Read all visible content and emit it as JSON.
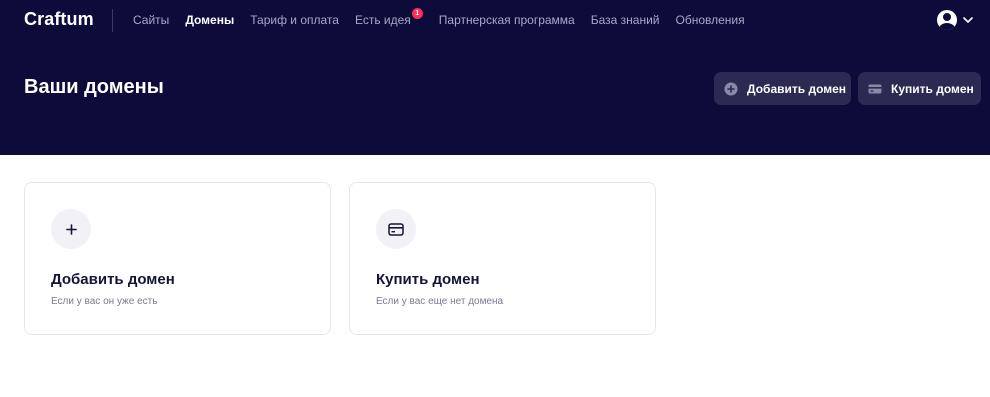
{
  "app": {
    "logo": "Craftum"
  },
  "nav": {
    "items": [
      {
        "label": "Сайты",
        "active": false
      },
      {
        "label": "Домены",
        "active": true
      },
      {
        "label": "Тариф и оплата",
        "active": false
      },
      {
        "label": "Есть идея",
        "active": false,
        "badge": "1"
      },
      {
        "label": "Партнерская программа",
        "active": false
      },
      {
        "label": "База знаний",
        "active": false
      },
      {
        "label": "Обновления",
        "active": false
      }
    ],
    "account_icon": "user-avatar-icon",
    "account_chevron_icon": "chevron-down-icon"
  },
  "header": {
    "title": "Ваши домены",
    "add_button": {
      "label": "Добавить домен",
      "icon": "plus-circle-icon"
    },
    "buy_button": {
      "label": "Купить домен",
      "icon": "credit-card-icon"
    }
  },
  "cards": [
    {
      "title": "Добавить домен",
      "subtitle": "Если у вас он уже есть",
      "icon": "plus-icon"
    },
    {
      "title": "Купить домен",
      "subtitle": "Если у вас еще нет домена",
      "icon": "credit-card-icon"
    }
  ],
  "colors": {
    "header_bg": "#0c0b3a",
    "button_bg": "#2a2a52",
    "badge": "#ff2d5a",
    "card_border": "#e6e6ee",
    "icon_circle": "#f1f1f6",
    "title_text": "#14133a",
    "muted_text": "#7b7a94"
  }
}
